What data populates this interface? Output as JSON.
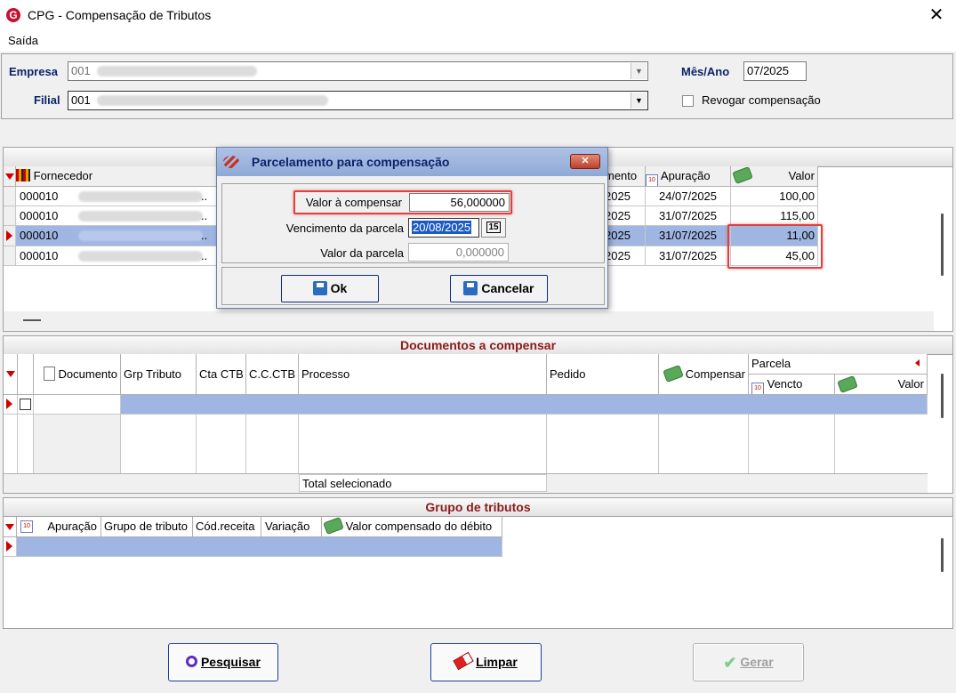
{
  "window": {
    "title": "CPG - Compensação de Tributos",
    "logo": "G",
    "close_icon": "✕"
  },
  "menu": {
    "saida": "Saída"
  },
  "header": {
    "empresa_label": "Empresa",
    "empresa_value": "001",
    "filial_label": "Filial",
    "filial_value": "001",
    "mes_ano_label": "Mês/Ano",
    "mes_ano_value": "07/2025",
    "revogar_label": "Revogar compensação"
  },
  "top_grid": {
    "columns": {
      "fornecedor": "Fornecedor",
      "vencimento": "mento",
      "apuracao": "Apuração",
      "valor": "Valor"
    },
    "rows": [
      {
        "fornecedor": "000010",
        "venc": "2025",
        "apuracao": "24/07/2025",
        "valor": "100,00"
      },
      {
        "fornecedor": "000010",
        "venc": "2025",
        "apuracao": "31/07/2025",
        "valor": "115,00"
      },
      {
        "fornecedor": "000010",
        "venc": "2025",
        "apuracao": "31/07/2025",
        "valor": "11,00"
      },
      {
        "fornecedor": "000010",
        "venc": "2025",
        "apuracao": "31/07/2025",
        "valor": "45,00"
      }
    ],
    "ellipsis": ".."
  },
  "dialog": {
    "title": "Parcelamento para compensação",
    "valor_label": "Valor à compensar",
    "valor_value": "56,000000",
    "venc_label": "Vencimento da parcela",
    "venc_value": "20/08/2025",
    "cal_btn": "15",
    "parcela_label": "Valor da parcela",
    "parcela_value": "0,000000",
    "ok_label": "Ok",
    "cancel_label": "Cancelar",
    "close_icon": "✕"
  },
  "docs": {
    "title": "Documentos a compensar",
    "columns": {
      "documento": "Documento",
      "grp_tributo": "Grp Tributo",
      "cta_ctb": "Cta CTB",
      "cc_ctb": "C.C.CTB",
      "processo": "Processo",
      "pedido": "Pedido",
      "compensar": "Compensar",
      "parcela": "Parcela",
      "vencto": "Vencto",
      "valor": "Valor"
    },
    "total_label": "Total selecionado"
  },
  "tributos": {
    "title": "Grupo de tributos",
    "columns": {
      "apuracao": "Apuração",
      "grupo": "Grupo de tributo",
      "cod_receita": "Cód.receita",
      "variacao": "Variação",
      "valor_comp": "Valor compensado do débito"
    }
  },
  "buttons": {
    "pesquisar": "Pesquisar",
    "limpar": "Limpar",
    "gerar": "Gerar"
  }
}
